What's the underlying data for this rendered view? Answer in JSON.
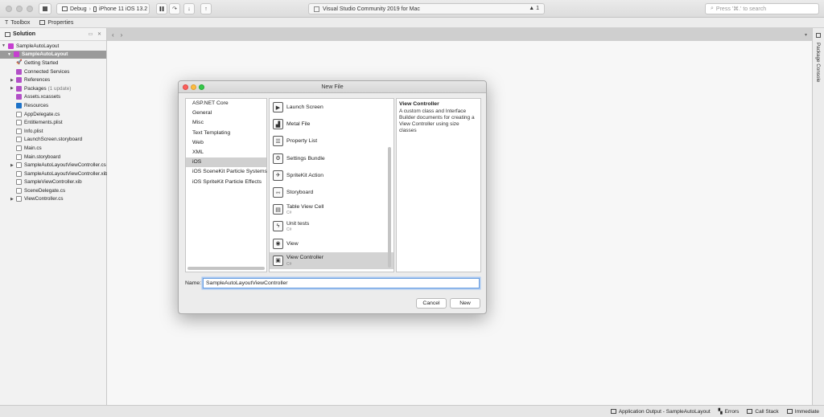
{
  "toolbar": {
    "config": "Debug",
    "device": "iPhone 11 iOS 13.2",
    "status": "Visual Studio Community 2019 for Mac",
    "warnings": "1",
    "search_placeholder": "Press '⌘.' to search"
  },
  "pads": {
    "toolbox": "Toolbox",
    "properties": "Properties",
    "package_console": "Package Console"
  },
  "solution": {
    "header": "Solution",
    "root": "SampleAutoLayout",
    "project": "SampleAutoLayout",
    "items": [
      {
        "label": "Getting Started",
        "icon": "rocket-icon"
      },
      {
        "label": "Connected Services",
        "icon": "services-icon"
      },
      {
        "label": "References",
        "icon": "folder-icon"
      },
      {
        "label": "Packages",
        "note": "(1 update)",
        "icon": "folder-icon"
      },
      {
        "label": "Assets.xcassets",
        "icon": "assets-icon"
      },
      {
        "label": "Resources",
        "icon": "folder-icon"
      },
      {
        "label": "AppDelegate.cs",
        "icon": "file-icon"
      },
      {
        "label": "Entitlements.plist",
        "icon": "file-icon"
      },
      {
        "label": "Info.plist",
        "icon": "file-icon"
      },
      {
        "label": "LaunchScreen.storyboard",
        "icon": "file-icon"
      },
      {
        "label": "Main.cs",
        "icon": "file-icon"
      },
      {
        "label": "Main.storyboard",
        "icon": "file-icon"
      },
      {
        "label": "SampleAutoLayoutViewController.cs",
        "icon": "file-icon"
      },
      {
        "label": "SampleAutoLayoutViewController.xib",
        "icon": "file-icon"
      },
      {
        "label": "SampleViewController.xib",
        "icon": "file-icon"
      },
      {
        "label": "SceneDelegate.cs",
        "icon": "file-icon"
      },
      {
        "label": "ViewController.cs",
        "icon": "file-icon"
      }
    ]
  },
  "bottom": {
    "output": "Application Output - SampleAutoLayout",
    "errors": "Errors",
    "callstack": "Call Stack",
    "immediate": "Immediate"
  },
  "dialog": {
    "title": "New File",
    "categories": [
      "ASP.NET Core",
      "General",
      "Misc",
      "Text Templating",
      "Web",
      "XML",
      "iOS",
      "iOS SceneKit Particle Systems",
      "iOS SpriteKit Particle Effects"
    ],
    "templates": [
      {
        "name": "Launch Screen",
        "sub": "",
        "glyph": "▶"
      },
      {
        "name": "Metal File",
        "sub": "",
        "glyph": "▟"
      },
      {
        "name": "Property List",
        "sub": "",
        "glyph": "☰"
      },
      {
        "name": "Settings Bundle",
        "sub": "",
        "glyph": "⚙"
      },
      {
        "name": "SpriteKit Action",
        "sub": "",
        "glyph": "✈"
      },
      {
        "name": "Storyboard",
        "sub": "",
        "glyph": "⇿"
      },
      {
        "name": "Table View Cell",
        "sub": "C#",
        "glyph": "▤"
      },
      {
        "name": "Unit tests",
        "sub": "C#",
        "glyph": "ϟ"
      },
      {
        "name": "View",
        "sub": "",
        "glyph": "◉"
      },
      {
        "name": "View Controller",
        "sub": "C#",
        "glyph": "▣"
      }
    ],
    "description_title": "View Controller",
    "description": "A custom class and Interface Builder documents for creating a View Controller using size classes",
    "name_label": "Name:",
    "name_value": "SampleAutoLayoutViewController",
    "cancel": "Cancel",
    "new": "New"
  }
}
